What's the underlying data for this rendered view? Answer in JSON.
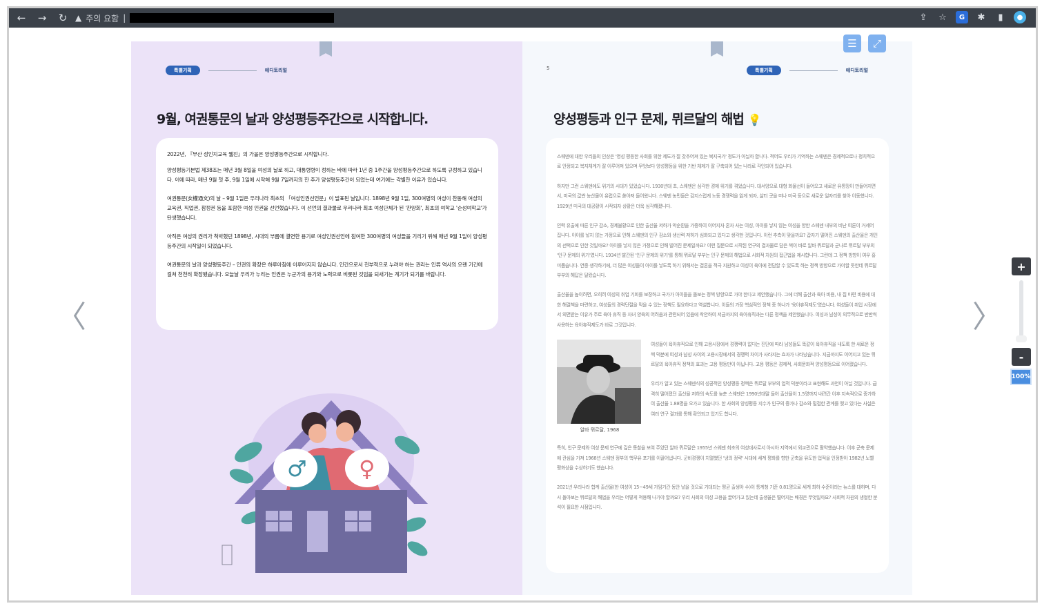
{
  "browser": {
    "address_prefix": "주의 요함",
    "address_separator": "|"
  },
  "header": {
    "badge": "특별기획",
    "label": "에디토리얼",
    "right_page_number": "5"
  },
  "left_page": {
    "title": "9월, 여권통문의 날과 양성평등주간으로 시작합니다.",
    "paragraphs": [
      "2022년, 『부산 성인지교육 웹진』의 가을은 양성평등주간으로 시작합니다.",
      "양성평등기본법 제38조는 매년 3월 8일을 여성의 날로 하고, 대통령령이 정하는 바에 따라 1년 중 1주간을 양성평등주간으로 하도록 규정하고 있습니다. 이에 따라, 매년 9월 첫 주, 9월 1일에 시작해 9월 7일까지의 한 주가 양성평등주간이 되었는데 여기에는 각별한 이유가 있습니다.",
      "여권통문(女權通文)의 날 – 9월 1일은 우리나라 최초의 「여성인권선언문」이 발표된 날입니다. 1898년 9월 1일, 300여명의 여성이 찬동해 여성의 교육권, 직업권, 참정권 등을 포함한 여성 인권을 선언했습니다. 이 선언의 결과물로 우리나라 최초 여성단체가 된 '찬양회', 최초의 여학교 '순성여학교'가 탄생했습니다.",
      "아직은 여성의 권리가 척박했던 1898년, 시대의 부름에 결연한 용기로 여성인권선언에 참여한 300여명의 여성들을 기리기 위해 매년 9월 1일이 양성평등주간의 시작일이 되었습니다.",
      "여권통문의 날과 양성평등주간 – 인권의 확장은 하루아침에 이루어지지 않습니다. 인간으로서 천부적으로 누려야 하는 권리는 인류 역사의 오랜 기간에 걸쳐 천천히 확장됐습니다. 오늘날 우리가 누리는 인권은 누군가의 용기와 노력으로 비롯된 것임을 되새기는 계기가 되기를 바랍니다."
    ]
  },
  "right_page": {
    "title": "양성평등과 인구 문제, 뮈르달의 해법",
    "paragraphs_top": [
      "스웨덴에 대한 우리들의 인상은 '영성 평등한 사회를 위한 제도가 잘 갖추어져 있는 복지국가' 정도가 아닐까 합니다. 적어도 우리가 기억하는 스웨덴은 경제적으로나 정치적으로 안정되고 복지체계가 잘 이루어져 있으며 무엇보다 양성평등을 위한 기반 체제가 잘 구축되어 있는 나라로 각인되어 있습니다.",
      "하지만 그런 스웨덴에도 위기의 시대가 있었습니다. 1930년대 초, 스웨덴은 심각한 경제 위기를 겪었습니다. 대서양으로 대형 화물선이 들어오고 새로운 유통망이 만들어지면서, 미국의 값싼 농산물이 유럽으로 쏟아져 들어왔니다. 스웨덴 농민들은 감지스럽게 노동 경쟁력을 잃게 되자, 삶터 곳을 떠나 미국 등으로 새로운 일자리를 찾아 이동했니다. 1929년 미국의 대공황이 시작되자 상황은 더욱 심각해졌니다.",
      "인력 유출에 따른 인구 감소, 경제불황으로 인한 출산율 저하가 악순환을 가중하여 이어지자 혼자 사는 여성, 아이를 낳지 않는 여성을 향한 스웨덴 내부의 비난 여론이 거세어집니다. 아이를 낳지 않는 가정으로 인해 스웨덴의 인구 감소와 생산력 저하가 심화되고 있다고 생각한 것입니다. 이런 추측이 맞을까요? 갑자기 떨어진 스웨덴의 출산율은 개인의 선택으로 인한 것일까요? 아이를 낳지 않은 가정으로 인해 벌어진 문제일까요? 이런 질문으로 시작된 연구의 결과물로 담은 책이 바로 알바 뮈르달과 군나르 뮈르달 부부의 '인구 문제의 위기'였니다. 1934년 발간된 '인구 문제의 위기'를 통해 뮈르달 부부는 인구 문제의 해법으로 사회적 차원의 접근법을 제시합니다. 그런데 그 정책 방향이 여우 흥미롭습니다. 연중 생각하기에, 더 많은 여성들이 아이를 낳도록 하기 위해서는 결혼을 적극 지원하고 여성이 육아에 전담할 수 있도록 하는 정책 방향으로 가야할 듯한데 뮈르달 부부의 해답은 달랐습니다.",
      "출산율을 높이려면, 오히려 여성의 취업 기회를 보장하고 국가가 아이들을 돌보는 정책 방향으로 가야 한다고 제안했습니다. 그에 더해 출산과 육아 비용, 내 집 마련 비용에 대한 해결책을 마련하고, 여성들의 경력단절을 막을 수 있는 정책도 필요하다고 역설합니다. 이들의 가장 핵심적인 정책 중 하나가 '육아휴직제도'였습니다. 여성들이 취업 시장에서 외면받는 이유가 주로 육아 휴직 등 자녀 양육의 어려움과 관련되어 있음에 착안하여 저금까지의 육아휴직과는 다른 정책을 제안했습니다. 여성과 남성이 의무적으로 반반씩 사용하는 육아휴직제도가 바로 그것입니다."
    ],
    "photo_caption": "알바 뮈르달, 1968",
    "photo_side_paragraphs": [
      "여성들이 육아휴직으로 인해 고용시장에서 경쟁력이 없다는 진단에 따라 남성들도 똑같이 육아휴직을 내도록 한 새로운 정책 덕분에 여성과 남성 사이의 고용시장에서의 경쟁력 차이가 사라지는 효과가 나타났습니다. 지금까지도 이어지고 있는 뮈르달의 육아휴직 정책의 효과는 고용 평등만이 아닙니다. 고용 평등은 경제적, 사회문화적 양성평등으로 이어졌습니다.",
      "우리가 알고 있는 스웨덴식의 성공적인 양성평등 정책은 뮈르달 부부의 업적 덕분이라고 표현해도 과언이 아닐 것입니다. 급격히 떨어졌던 출산율 저하의 속도를 늦춘 스웨덴은 1990년대말 들어 출산율이 1.5명까지 내려간 이후 지속적으로 증가하여 출산율 1.88명을 오가고 있습니다. 한 사회의 양성평등 지수가 인구의 증가나 감소와 밀접한 관계를 맺고 있다는 사실은 여러 연구 결과를 통해 확인되고 있기도 합니다."
    ],
    "paragraphs_bottom": [
      "특히, 인구 문제와 여성 문제 연구에 깊은 통찰을 보여 주었던 알바 뮈르달은 1955년 스웨덴 최초의 여성대사로서 아시아 지역에서 외교관으로 활약했습니다. 이후 군축 문제에 관심을 가져 1968년 스웨덴 정부의 핵무유 포기를 이끌어냅니다. 군비경쟁이 치열했던 '냉의 정략' 시대에 세계 평화를 향한 군축을 유도한 업적을 인정받아 1982년 노벨 평화상을 수상하기도 했습니다.",
      "2021년 우리나라 합계 출산율(한 여성이 15~49세 가임기간 동안 낳을 것으로 기대되는 평균 출생아 수)이 통계청 기준 0.81명으로 세계 최하 수준이라는 뉴스를 대하며, 다시 돌아보는 뮈르달의 해법을 우리는 어떻게 적용해 나가야 할까요? 우리 사회의 여성 고용을 끌어가고 있는데 출생율은 떨어지는 배경은 무엇일까요? 사회적 차원의 냉철한 분석이 필요한 시점입니다."
    ]
  },
  "viewer": {
    "zoom_plus": "+",
    "zoom_minus": "-",
    "zoom_level": "100%",
    "prev_arrow": "〈",
    "next_arrow": "〉",
    "menu_icon": "☰",
    "fullscreen_icon": "⤢",
    "bulb_icon": "💡"
  }
}
